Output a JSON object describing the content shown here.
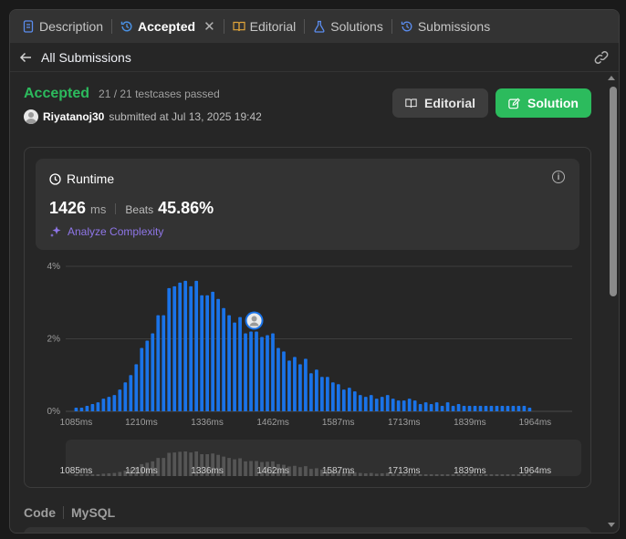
{
  "tabs": [
    {
      "label": "Description",
      "icon": "document-icon",
      "active": false
    },
    {
      "label": "Accepted",
      "icon": "history-icon",
      "active": true
    },
    {
      "label": "Editorial",
      "icon": "book-icon",
      "active": false
    },
    {
      "label": "Solutions",
      "icon": "flask-icon",
      "active": false
    },
    {
      "label": "Submissions",
      "icon": "history-icon",
      "active": false
    }
  ],
  "close_glyph": "✕",
  "subheader": {
    "back_label": "All Submissions"
  },
  "submission": {
    "status": "Accepted",
    "testcases": "21 / 21 testcases passed",
    "username": "Riyatanoj30",
    "submitted_text": "submitted at Jul 13, 2025 19:42"
  },
  "buttons": {
    "editorial": "Editorial",
    "solution": "Solution"
  },
  "runtime": {
    "title": "Runtime",
    "value": "1426",
    "unit": "ms",
    "beats_label": "Beats",
    "beats_value": "45.86%",
    "analyze_label": "Analyze Complexity"
  },
  "code_section": {
    "label": "Code",
    "language": "MySQL"
  },
  "colors": {
    "accent_green": "#2cbb5d",
    "bar_blue": "#1a73e8",
    "analyze_purple": "#8f76e8"
  },
  "chart_data": {
    "type": "bar",
    "y_tick_labels": [
      "0%",
      "2%",
      "4%"
    ],
    "ylim": [
      0,
      4
    ],
    "x_tick_labels": [
      "1085ms",
      "1210ms",
      "1336ms",
      "1462ms",
      "1587ms",
      "1713ms",
      "1839ms",
      "1964ms"
    ],
    "xlim_ms": [
      1065,
      2035
    ],
    "bar_width_ms": 10.5,
    "marker_ms": 1426,
    "grid": true,
    "values": [
      0.1,
      0.1,
      0.15,
      0.2,
      0.25,
      0.35,
      0.4,
      0.45,
      0.6,
      0.8,
      1.0,
      1.3,
      1.75,
      1.95,
      2.15,
      2.65,
      2.65,
      3.4,
      3.45,
      3.55,
      3.6,
      3.45,
      3.6,
      3.2,
      3.2,
      3.3,
      3.1,
      2.85,
      2.65,
      2.45,
      2.6,
      2.15,
      2.2,
      2.2,
      2.05,
      2.1,
      2.15,
      1.75,
      1.65,
      1.4,
      1.5,
      1.3,
      1.45,
      1.05,
      1.15,
      0.95,
      0.95,
      0.8,
      0.75,
      0.6,
      0.65,
      0.55,
      0.45,
      0.4,
      0.45,
      0.35,
      0.4,
      0.45,
      0.35,
      0.3,
      0.3,
      0.35,
      0.3,
      0.2,
      0.25,
      0.2,
      0.25,
      0.15,
      0.25,
      0.15,
      0.2,
      0.15,
      0.15,
      0.15,
      0.15,
      0.15,
      0.15,
      0.15,
      0.15,
      0.15,
      0.15,
      0.15,
      0.15,
      0.1
    ]
  }
}
